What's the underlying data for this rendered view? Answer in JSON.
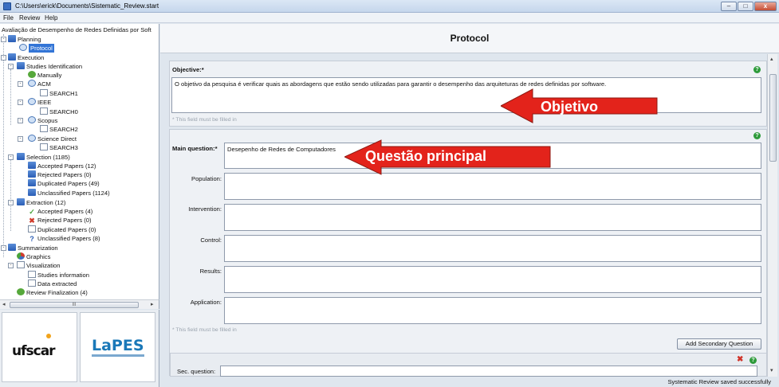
{
  "window": {
    "title": "C:\\Users\\erick\\Documents\\Sistematic_Review.start",
    "minimize": "–",
    "maximize": "□",
    "close": "x"
  },
  "menu": [
    "File",
    "Review",
    "Help"
  ],
  "tree": {
    "root": "Avaliação de Desempenho de Redes Definidas por Soft",
    "items": [
      "Planning",
      "Protocol",
      "Execution",
      "Studies Identification",
      "Manually",
      "ACM",
      "SEARCH1",
      "IEEE",
      "SEARCH0",
      "Scopus",
      "SEARCH2",
      "Science Direct",
      "SEARCH3",
      "Selection (1185)",
      "Accepted Papers (12)",
      "Rejected Papers (0)",
      "Duplicated Papers (49)",
      "Unclassified Papers (1124)",
      "Extraction (12)",
      "Accepted Papers (4)",
      "Rejected Papers (0)",
      "Duplicated Papers (0)",
      "Unclassified Papers (8)",
      "Summarization",
      "Graphics",
      "Visualization",
      "Studies information",
      "Data extracted",
      "Review Finalization (4)"
    ]
  },
  "scroll": {
    "grip": "III",
    "left": "◂",
    "right": "▸",
    "up": "▴",
    "down": "▾"
  },
  "logos": {
    "ufscar": "ufscar",
    "lapes": "LaPES"
  },
  "main": {
    "title": "Protocol",
    "objective_label": "Objective:*",
    "objective_value": "O objetivo da pesquisa é verificar quais as abordagens que estão sendo utilizadas para garantir o desempenho das arquiteturas de redes definidas  por software.",
    "must_fill_hint": "* This field must be filled in",
    "main_question_label": "Main question:*",
    "main_question_value": "Desepenho de Redes de Computadores",
    "population_label": "Population:",
    "intervention_label": "Intervention:",
    "control_label": "Control:",
    "results_label": "Results:",
    "application_label": "Application:",
    "add_secondary_button": "Add Secondary Question",
    "sec_question_label": "Sec. question:",
    "help_glyph": "?",
    "delete_glyph": "✖"
  },
  "annotations": {
    "objetivo": "Objetivo",
    "questao": "Questão principal",
    "arrow_color": "#e3231b"
  },
  "status": "Systematic Review saved successfully"
}
